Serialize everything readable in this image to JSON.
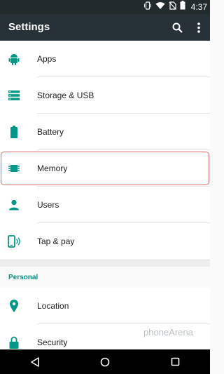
{
  "status_bar": {
    "time": "4:37",
    "icons": [
      "vibrate-icon",
      "wifi-icon",
      "no-sim-icon",
      "battery-icon"
    ]
  },
  "app_bar": {
    "title": "Settings",
    "actions": [
      "search-icon",
      "more-vert-icon"
    ]
  },
  "device_section": {
    "items": [
      {
        "label": "Apps",
        "icon": "android-icon"
      },
      {
        "label": "Storage & USB",
        "icon": "storage-icon"
      },
      {
        "label": "Battery",
        "icon": "battery-icon"
      },
      {
        "label": "Memory",
        "icon": "memory-icon"
      },
      {
        "label": "Users",
        "icon": "person-icon"
      },
      {
        "label": "Tap & pay",
        "icon": "tap-pay-icon"
      }
    ]
  },
  "personal_section": {
    "header": "Personal",
    "items": [
      {
        "label": "Location",
        "icon": "location-icon"
      },
      {
        "label": "Security",
        "icon": "lock-icon"
      }
    ]
  },
  "nav_bar": {
    "buttons": [
      "back-icon",
      "home-icon",
      "recents-icon"
    ]
  },
  "watermark": "phoneArena",
  "colors": {
    "accent": "#009688",
    "app_bar": "#263238",
    "status_bar": "#212b2e",
    "highlight": "#e0686e"
  }
}
